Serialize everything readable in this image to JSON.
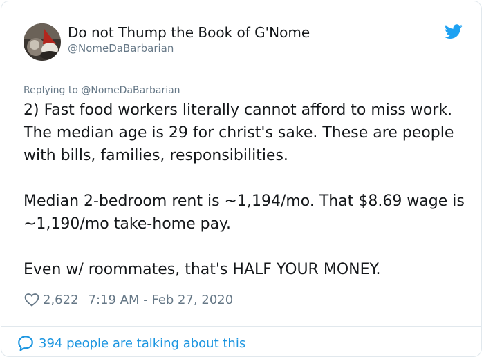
{
  "author": {
    "display_name": "Do not Thump the Book of G'Nome",
    "handle": "@NomeDaBarbarian"
  },
  "reply": {
    "prefix": "Replying to ",
    "mention": "@NomeDaBarbarian"
  },
  "tweet": {
    "paragraphs": [
      "2) Fast food workers literally cannot afford to miss work. The median age is 29 for christ's sake. These are people with bills, families, responsibilities.",
      "Median 2-bedroom rent is ~1,194/mo. That $8.69 wage is ~1,190/mo take-home pay.",
      "Even w/ roommates, that's HALF YOUR MONEY."
    ]
  },
  "meta": {
    "likes": "2,622",
    "timestamp": "7:19 AM - Feb 27, 2020"
  },
  "footer": {
    "talking": "394 people are talking about this"
  },
  "icons": {
    "brand": "twitter-bird-icon",
    "like": "heart-icon",
    "reply": "speech-bubble-icon"
  },
  "colors": {
    "accent": "#1da1f2",
    "link": "#1b95e0",
    "secondary_text": "#657786",
    "primary_text": "#14171a",
    "border": "#e1e8ed"
  }
}
